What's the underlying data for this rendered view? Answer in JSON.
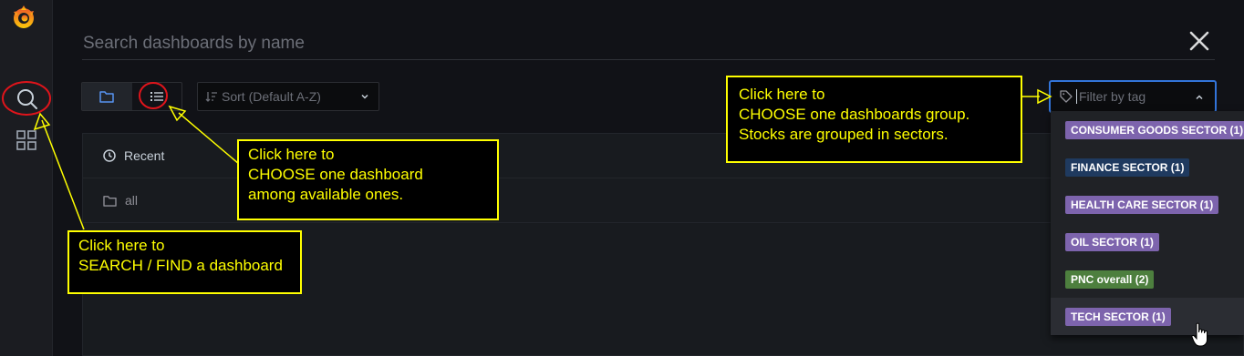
{
  "search": {
    "placeholder": "Search dashboards by name"
  },
  "view_toggle": {
    "modes": [
      "folders",
      "list"
    ],
    "active": "folders"
  },
  "sort": {
    "label": "Sort (Default A-Z)"
  },
  "list": {
    "rows": [
      {
        "label": "Recent",
        "icon": "clock-icon"
      },
      {
        "label": "all",
        "icon": "folder-icon"
      }
    ]
  },
  "tag_filter": {
    "placeholder": "Filter by tag",
    "tags": [
      {
        "label": "CONSUMER GOODS SECTOR",
        "count": "(1)",
        "color": "#7d64ad"
      },
      {
        "label": "FINANCE SECTOR",
        "count": "(1)",
        "color": "#1f3a5f"
      },
      {
        "label": "HEALTH CARE SECTOR",
        "count": "(1)",
        "color": "#7d64ad"
      },
      {
        "label": "OIL SECTOR",
        "count": "(1)",
        "color": "#7d64ad"
      },
      {
        "label": "PNC overall",
        "count": "(2)",
        "color": "#4d7f3e"
      },
      {
        "label": "TECH SECTOR",
        "count": "(1)",
        "color": "#7d64ad"
      }
    ]
  },
  "annotations": {
    "search": "Click here to\nSEARCH / FIND a dashboard",
    "list_view": "Click here to\nCHOOSE one dashboard\namong  available ones.",
    "tag_filter": "Click here to\nCHOOSE one dashboards group.\nStocks are grouped in sectors."
  },
  "colors": {
    "accent": "#3274d9",
    "annotation": "#ffff00",
    "highlight_circle": "#e0141b"
  }
}
